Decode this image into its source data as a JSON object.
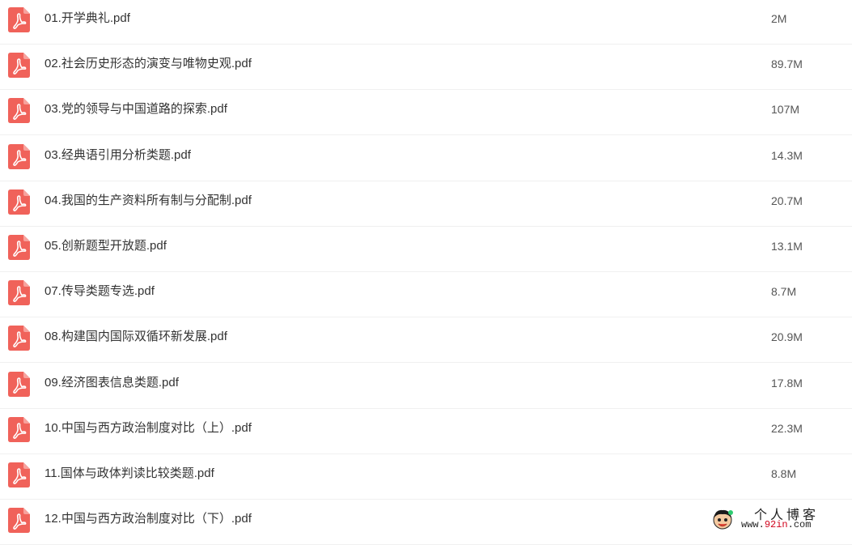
{
  "files": [
    {
      "name": "01.开学典礼.pdf",
      "size": "2M",
      "icon": "pdf-icon"
    },
    {
      "name": "02.社会历史形态的演变与唯物史观.pdf",
      "size": "89.7M",
      "icon": "pdf-icon"
    },
    {
      "name": "03.党的领导与中国道路的探索.pdf",
      "size": "107M",
      "icon": "pdf-icon"
    },
    {
      "name": "03.经典语引用分析类题.pdf",
      "size": "14.3M",
      "icon": "pdf-icon"
    },
    {
      "name": "04.我国的生产资料所有制与分配制.pdf",
      "size": "20.7M",
      "icon": "pdf-icon"
    },
    {
      "name": "05.创新题型开放题.pdf",
      "size": "13.1M",
      "icon": "pdf-icon"
    },
    {
      "name": "07.传导类题专选.pdf",
      "size": "8.7M",
      "icon": "pdf-icon"
    },
    {
      "name": "08.构建国内国际双循环新发展.pdf",
      "size": "20.9M",
      "icon": "pdf-icon"
    },
    {
      "name": "09.经济图表信息类题.pdf",
      "size": "17.8M",
      "icon": "pdf-icon"
    },
    {
      "name": "10.中国与西方政治制度对比（上）.pdf",
      "size": "22.3M",
      "icon": "pdf-icon"
    },
    {
      "name": "11.国体与政体判读比较类题.pdf",
      "size": "8.8M",
      "icon": "pdf-icon"
    },
    {
      "name": "12.中国与西方政治制度对比（下）.pdf",
      "size": "",
      "icon": "pdf-icon"
    }
  ],
  "watermark": {
    "title": "个人博客",
    "url_prefix": "www.",
    "url_highlight": "92in",
    "url_suffix": ".com"
  },
  "colors": {
    "pdf_icon": "#f0625a",
    "divider": "#f0f0f0",
    "text": "#333333"
  }
}
